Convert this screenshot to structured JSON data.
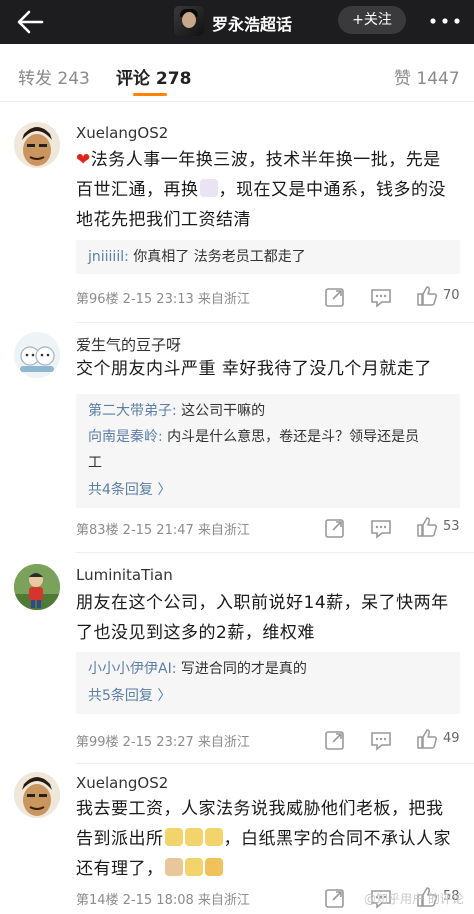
{
  "header": {
    "topic_title": "罗永浩超话",
    "follow_label": "+关注"
  },
  "tabs": [
    {
      "label": "转发 243"
    },
    {
      "label": "评论 278"
    },
    {
      "label": "赞 1447"
    }
  ],
  "comments": [
    {
      "user": "XuelangOS2",
      "text_line1": "法务人事一年换三波，技术半年换一批，先是",
      "text_line2_a": "百世汇通，再换",
      "text_line2_b": "，现在又是中通系，钱多的没",
      "text_line3": "地花先把我们工资结清",
      "replies": [
        {
          "user": "jniiiiil:",
          "text": " 你真相了 法务老员工都走了"
        }
      ],
      "meta": "第96楼 2-15 23:13 来自浙江",
      "likes": "70"
    },
    {
      "user": "爱生气的豆子呀",
      "text_line1": "交个朋友内斗严重 幸好我待了没几个月就走了",
      "replies": [
        {
          "user": "第二大带弟子:",
          "text": " 这公司干嘛的"
        },
        {
          "user": "向南是秦岭:",
          "text": " 内斗是什么意思，卷还是斗？领导还是员"
        },
        {
          "text": "工"
        }
      ],
      "more_replies": "共4条回复 〉",
      "meta": "第83楼 2-15 21:47 来自浙江",
      "likes": "53"
    },
    {
      "user": "LuminitaTian",
      "text_line1": "朋友在这个公司，入职前说好14薪，呆了快两年",
      "text_line2": "了也没见到这多的2薪，维权难",
      "replies": [
        {
          "user": "小小小伊伊AI:",
          "text": " 写进合同的才是真的"
        }
      ],
      "more_replies": "共5条回复 〉",
      "meta": "第99楼 2-15 23:27 来自浙江",
      "likes": "49"
    },
    {
      "user": "XuelangOS2",
      "text_line1": "我去要工资，人家法务说我威胁他们老板，把我",
      "text_line2_a": "告到派出所",
      "text_line2_b": "，白纸黑字的合同不承认人家",
      "text_line3_a": "还有理了，",
      "meta": "第14楼 2-15 18:08 来自浙江",
      "likes": "58"
    }
  ],
  "watermark": "@知乎用户 的评论",
  "colors": {
    "accent": "#ff8200",
    "link": "#5b7fa6",
    "topbar": "#1d1d1f"
  }
}
